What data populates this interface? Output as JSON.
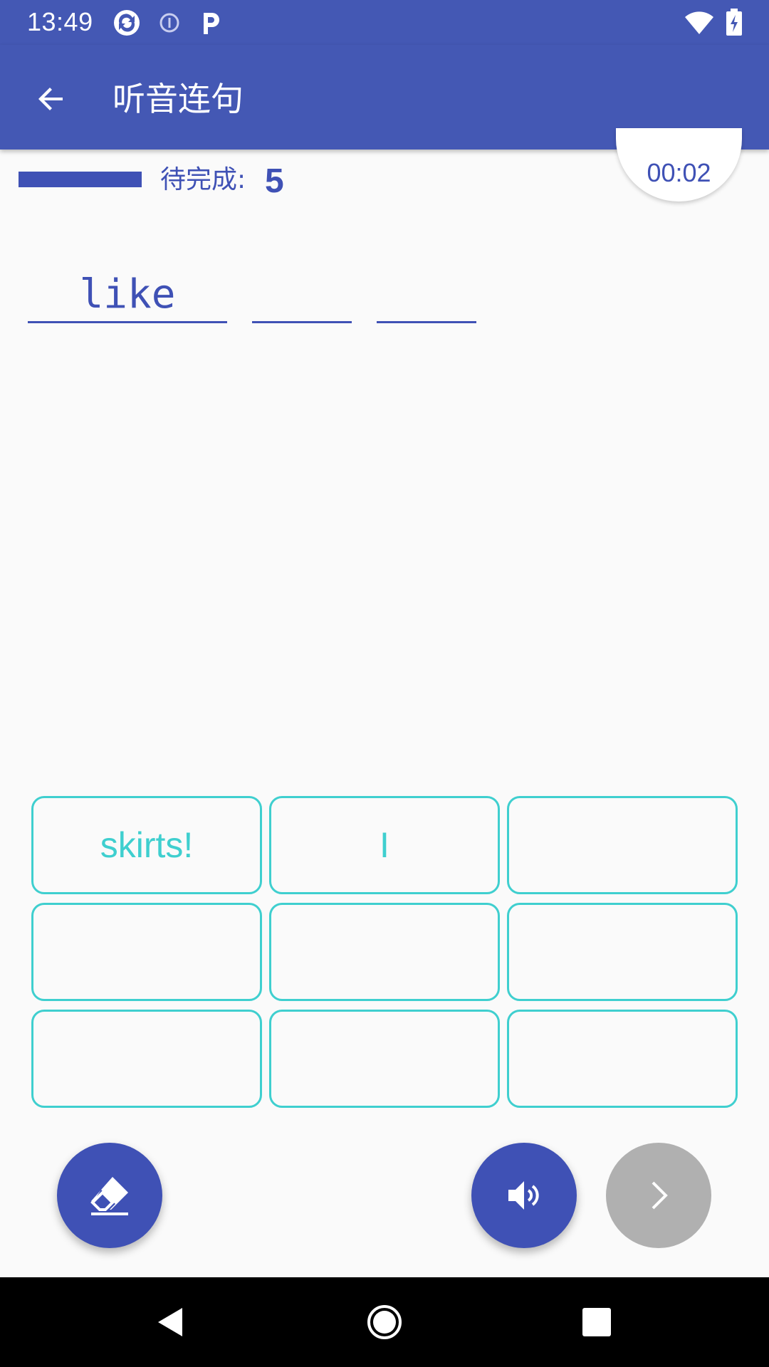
{
  "status_bar": {
    "time": "13:49",
    "icons": [
      "sync-app-icon",
      "info-circle-icon",
      "parking-app-icon",
      "wifi-icon",
      "battery-charging-icon"
    ]
  },
  "app_bar": {
    "title": "听音连句",
    "back_icon": "arrow-left-icon"
  },
  "progress": {
    "fraction": 1.0,
    "pending_label": "待完成:",
    "pending_count": "5",
    "timer": "00:02"
  },
  "answer": {
    "slots": [
      "like",
      "",
      ""
    ]
  },
  "tiles": [
    "skirts!",
    "I",
    "",
    "",
    "",
    "",
    "",
    "",
    ""
  ],
  "actions": {
    "erase_icon": "eraser-icon",
    "play_icon": "speaker-icon",
    "next_icon": "chevron-right-icon",
    "next_enabled": false
  },
  "nav_bar": {
    "icons": [
      "back-triangle-icon",
      "home-circle-icon",
      "recents-square-icon"
    ]
  },
  "colors": {
    "primary": "#3f51b5",
    "app_bar": "#4458b4",
    "tile_accent": "#3fcfcf",
    "disabled": "#b0b0b0",
    "background": "#fafafa"
  }
}
